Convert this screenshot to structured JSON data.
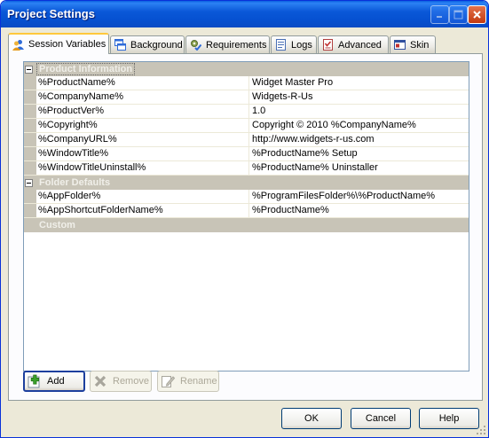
{
  "window": {
    "title": "Project Settings"
  },
  "tabs": [
    {
      "label": "Session Variables",
      "icon": "users-icon",
      "active": true
    },
    {
      "label": "Background",
      "icon": "window-icon"
    },
    {
      "label": "Requirements",
      "icon": "gear-check-icon"
    },
    {
      "label": "Logs",
      "icon": "log-icon"
    },
    {
      "label": "Advanced",
      "icon": "checklist-icon"
    },
    {
      "label": "Skin",
      "icon": "skin-icon"
    }
  ],
  "groups": {
    "product": {
      "label": "Product Information",
      "rows": [
        {
          "name": "%ProductName%",
          "value": "Widget Master Pro"
        },
        {
          "name": "%CompanyName%",
          "value": "Widgets-R-Us"
        },
        {
          "name": "%ProductVer%",
          "value": "1.0"
        },
        {
          "name": "%Copyright%",
          "value": "Copyright © 2010 %CompanyName%"
        },
        {
          "name": "%CompanyURL%",
          "value": "http://www.widgets-r-us.com"
        },
        {
          "name": "%WindowTitle%",
          "value": "%ProductName% Setup"
        },
        {
          "name": "%WindowTitleUninstall%",
          "value": "%ProductName% Uninstaller"
        }
      ]
    },
    "folder": {
      "label": "Folder Defaults",
      "rows": [
        {
          "name": "%AppFolder%",
          "value": "%ProgramFilesFolder%\\%ProductName%"
        },
        {
          "name": "%AppShortcutFolderName%",
          "value": "%ProductName%"
        }
      ]
    },
    "custom": {
      "label": "Custom"
    }
  },
  "actions": {
    "add": "Add",
    "remove": "Remove",
    "rename": "Rename"
  },
  "dialog": {
    "ok": "OK",
    "cancel": "Cancel",
    "help": "Help"
  }
}
